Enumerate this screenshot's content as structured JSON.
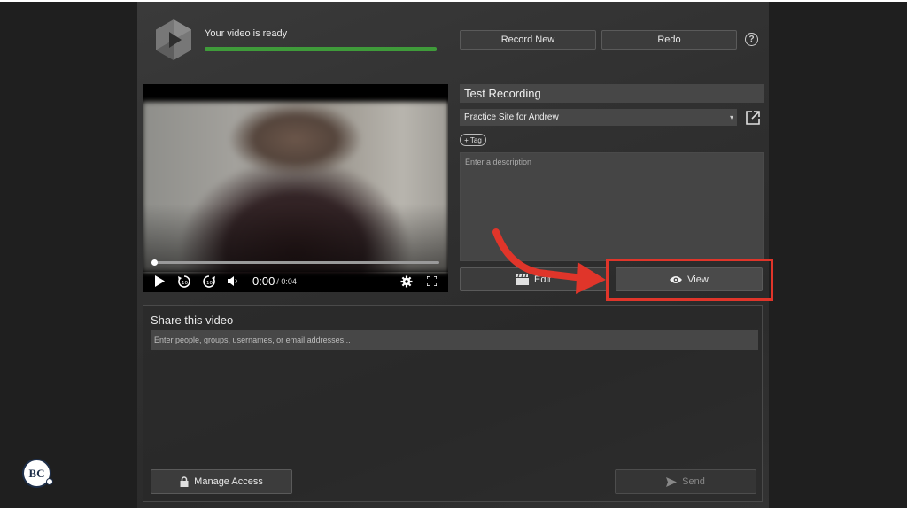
{
  "header": {
    "status_text": "Your video is ready",
    "progress": 1.0,
    "progress_color": "#3f9b3a",
    "record_new_label": "Record New",
    "redo_label": "Redo",
    "help_icon": "?"
  },
  "video": {
    "current_time": "0:00",
    "duration": "/ 0:04",
    "icons": [
      "play-icon",
      "rewind-10-icon",
      "forward-10-icon",
      "volume-icon",
      "settings-gear-icon",
      "fullscreen-icon"
    ]
  },
  "details": {
    "title_value": "Test Recording",
    "folder_value": "Practice Site for Andrew",
    "tag_label": "+ Tag",
    "description_placeholder": "Enter a description",
    "edit_label": "Edit",
    "view_label": "View"
  },
  "share": {
    "title": "Share this video",
    "placeholder": "Enter people, groups, usernames, or email addresses...",
    "manage_access_label": "Manage Access",
    "send_label": "Send"
  },
  "annotation": {
    "highlight_color": "#e0352a"
  },
  "badge": {
    "text": "BC"
  }
}
